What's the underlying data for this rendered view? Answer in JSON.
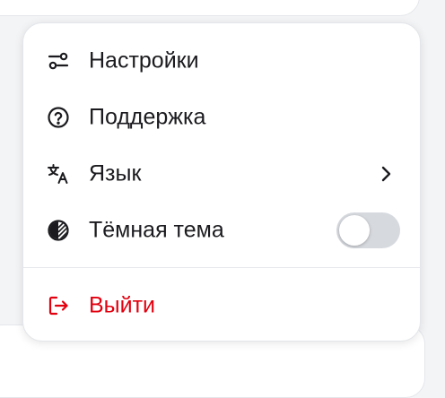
{
  "menu": {
    "items": [
      {
        "label": "Настройки",
        "icon": "settings-sliders-icon"
      },
      {
        "label": "Поддержка",
        "icon": "help-circle-icon"
      },
      {
        "label": "Язык",
        "icon": "translate-icon",
        "trailing": "chevron-right-icon"
      },
      {
        "label": "Тёмная тема",
        "icon": "theme-contrast-icon",
        "toggle_on": false
      }
    ],
    "logout": {
      "label": "Выйти",
      "icon": "logout-icon",
      "color": "#e3000f"
    }
  },
  "colors": {
    "text": "#1b1b1f",
    "danger": "#e3000f",
    "toggle_off": "#d6d9de",
    "background": "#f3f4f6"
  }
}
